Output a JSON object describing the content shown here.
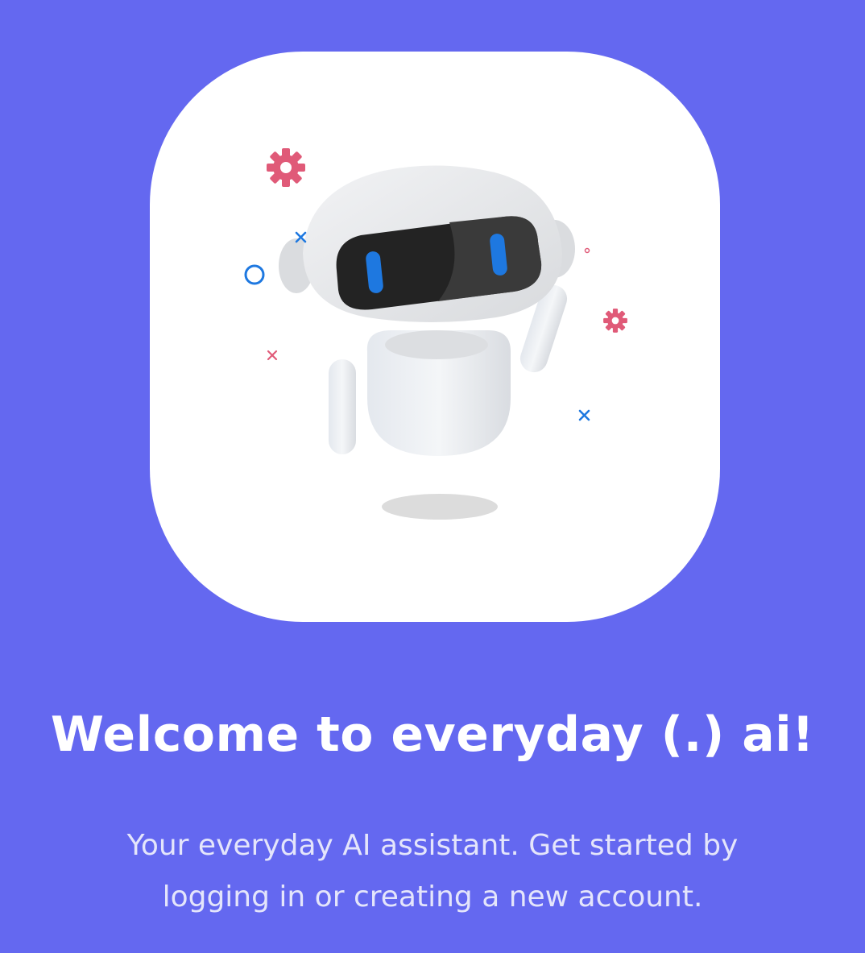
{
  "welcome": {
    "title": "Welcome to everyday (.) ai!",
    "subtitle": "Your everyday AI assistant. Get started by logging in or creating a new account."
  },
  "illustration": {
    "subject": "robot-mascot",
    "decorations": [
      "gear-icon",
      "gear-icon",
      "cross-icon",
      "cross-icon",
      "cross-icon",
      "circle-icon",
      "dot-icon"
    ]
  },
  "colors": {
    "background": "#6468F0",
    "card": "#FFFFFF",
    "accent_pink": "#E05A78",
    "accent_blue": "#1E78E0",
    "visor": "#222222"
  }
}
